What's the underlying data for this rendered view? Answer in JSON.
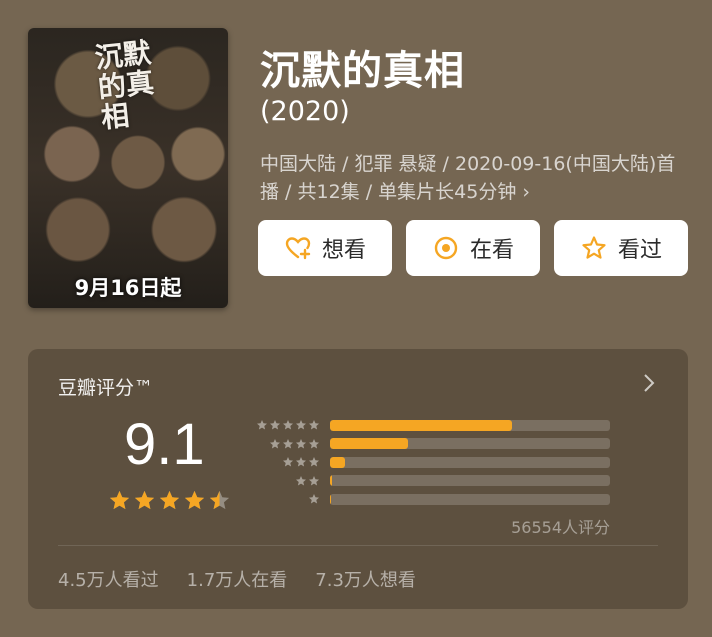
{
  "poster": {
    "calligraphy": "沉默的真相",
    "date_text": "9月16日起"
  },
  "header": {
    "title": "沉默的真相",
    "year": "(2020)",
    "meta": "中国大陆 / 犯罪 悬疑 / 2020-09-16(中国大陆)首播 / 共12集 / 单集片长45分钟"
  },
  "actions": [
    {
      "label": "想看",
      "icon": "heart-plus-icon"
    },
    {
      "label": "在看",
      "icon": "target-circle-icon"
    },
    {
      "label": "看过",
      "icon": "star-outline-icon"
    }
  ],
  "rating": {
    "label": "豆瓣评分™",
    "score": "9.1",
    "stars": 4.5,
    "distribution": [
      {
        "stars": 5,
        "percent": 65
      },
      {
        "stars": 4,
        "percent": 28
      },
      {
        "stars": 3,
        "percent": 5.5
      },
      {
        "stars": 2,
        "percent": 0.7
      },
      {
        "stars": 1,
        "percent": 0.3
      }
    ],
    "count": "56554人评分"
  },
  "stats": {
    "watched": "4.5万人看过",
    "watching": "1.7万人在看",
    "want": "7.3万人想看"
  },
  "colors": {
    "background": "#756652",
    "accent": "#f5a623"
  }
}
